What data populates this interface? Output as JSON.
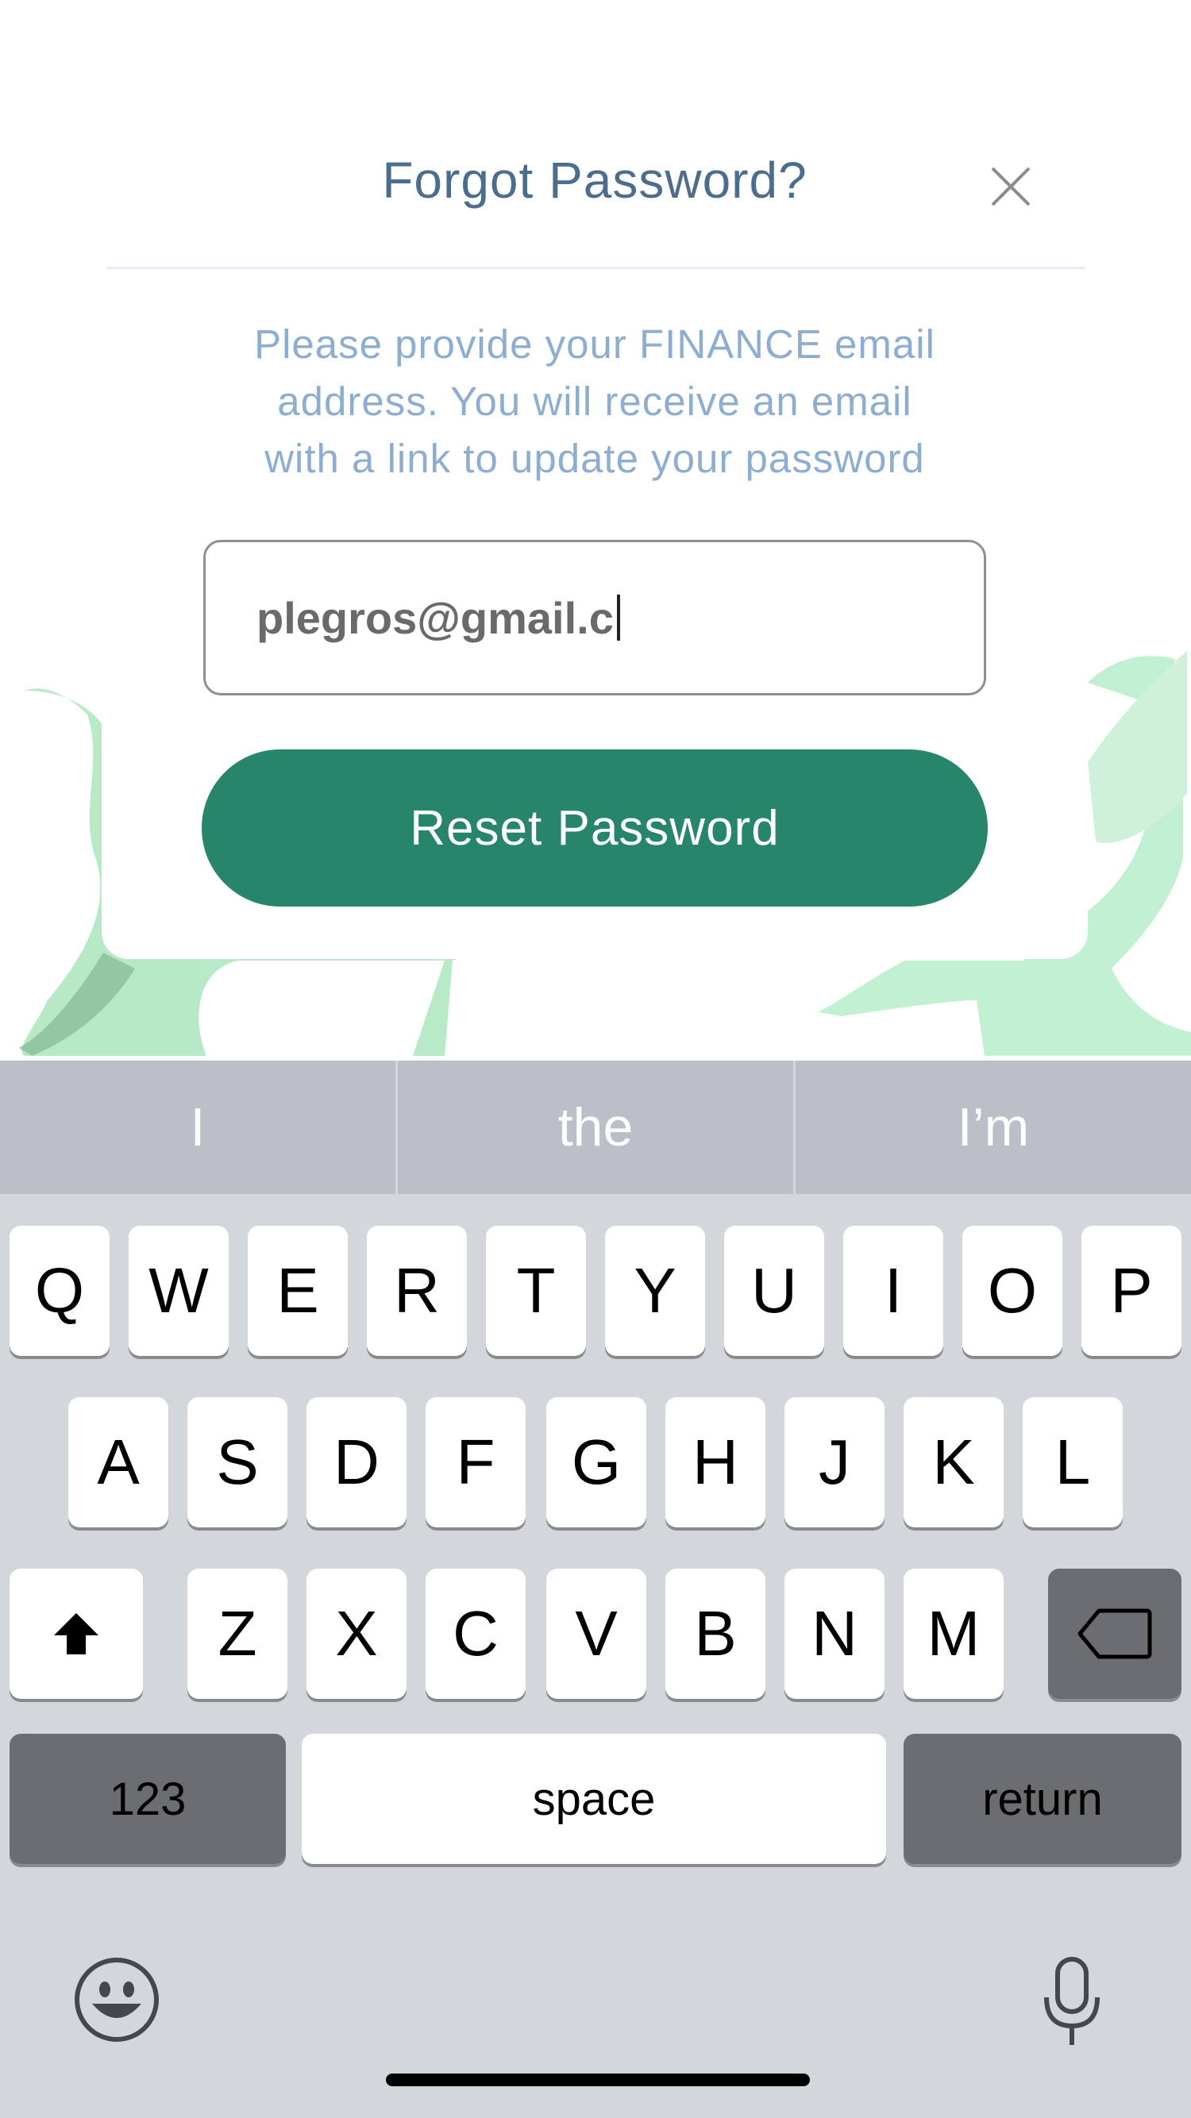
{
  "modal": {
    "title": "Forgot Password?",
    "description_lines": [
      "Please provide your FINANCE email",
      "address. You will receive an email",
      "with a link to update your password"
    ],
    "email_value": "plegros@gmail.c",
    "reset_button_label": "Reset Password",
    "close_icon": "close-icon"
  },
  "colors": {
    "title": "#4d6d8f",
    "description": "#8eaed1",
    "button": "#27856a",
    "keyboard_bg": "#d3d6db"
  },
  "keyboard": {
    "suggestions": [
      "I",
      "the",
      "I’m"
    ],
    "row1": [
      "Q",
      "W",
      "E",
      "R",
      "T",
      "Y",
      "U",
      "I",
      "O",
      "P"
    ],
    "row2": [
      "A",
      "S",
      "D",
      "F",
      "G",
      "H",
      "J",
      "K",
      "L"
    ],
    "row3": [
      "Z",
      "X",
      "C",
      "V",
      "B",
      "N",
      "M"
    ],
    "numbers_label": "123",
    "space_label": "space",
    "return_label": "return",
    "icons": [
      "shift-icon",
      "backspace-icon",
      "emoji-icon",
      "microphone-icon"
    ]
  }
}
